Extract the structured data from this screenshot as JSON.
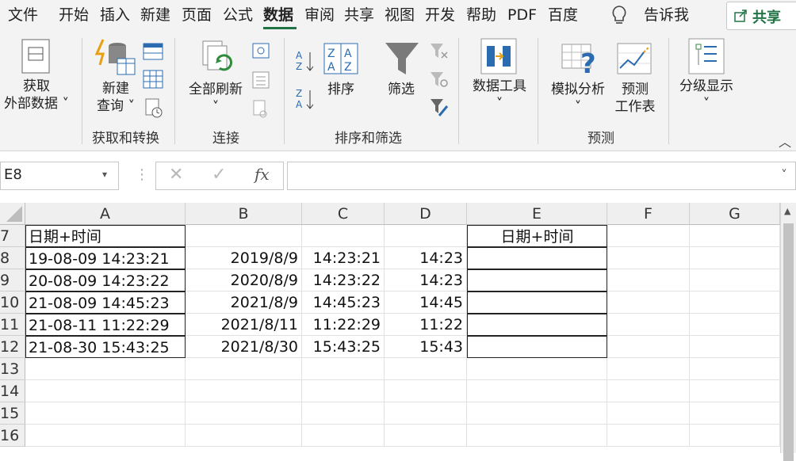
{
  "tabs": [
    "文件",
    "开始",
    "插入",
    "新建",
    "页面",
    "公式",
    "数据",
    "审阅",
    "共享",
    "视图",
    "开发",
    "帮助",
    "PDF",
    "百度"
  ],
  "active_tab": "数据",
  "tell_me": "告诉我",
  "share_label": "共享",
  "ribbon": {
    "get_external_data": [
      "获取",
      "外部数据"
    ],
    "new_query": [
      "新建",
      "查询"
    ],
    "group_get_transform": "获取和转换",
    "refresh_all": "全部刷新",
    "group_connections": "连接",
    "sort": "排序",
    "filter": "筛选",
    "group_sort_filter": "排序和筛选",
    "data_tools": "数据工具",
    "what_if": "模拟分析",
    "forecast_sheet": [
      "预测",
      "工作表"
    ],
    "group_forecast": "预测",
    "outline": "分级显示"
  },
  "formula_bar": {
    "name_box": "E8",
    "cancel": "✕",
    "enter": "✓",
    "fx": "fx",
    "formula": ""
  },
  "columns": [
    "A",
    "B",
    "C",
    "D",
    "E",
    "F",
    "G"
  ],
  "rows": [
    {
      "num": "7",
      "A": "日期+时间",
      "B": "",
      "C": "",
      "D": "",
      "E": "日期+时间"
    },
    {
      "num": "8",
      "A": "19-08-09 14:23:21",
      "B": "2019/8/9",
      "C": "14:23:21",
      "D": "14:23",
      "E": ""
    },
    {
      "num": "9",
      "A": "20-08-09 14:23:22",
      "B": "2020/8/9",
      "C": "14:23:22",
      "D": "14:23",
      "E": ""
    },
    {
      "num": "10",
      "A": "21-08-09 14:45:23",
      "B": "2021/8/9",
      "C": "14:45:23",
      "D": "14:45",
      "E": ""
    },
    {
      "num": "11",
      "A": "21-08-11 11:22:29",
      "B": "2021/8/11",
      "C": "11:22:29",
      "D": "11:22",
      "E": ""
    },
    {
      "num": "12",
      "A": "21-08-30 15:43:25",
      "B": "2021/8/30",
      "C": "15:43:25",
      "D": "15:43",
      "E": ""
    },
    {
      "num": "13",
      "A": "",
      "B": "",
      "C": "",
      "D": "",
      "E": ""
    },
    {
      "num": "14",
      "A": "",
      "B": "",
      "C": "",
      "D": "",
      "E": ""
    },
    {
      "num": "15",
      "A": "",
      "B": "",
      "C": "",
      "D": "",
      "E": ""
    },
    {
      "num": "16",
      "A": "",
      "B": "",
      "C": "",
      "D": "",
      "E": ""
    }
  ],
  "colors": {
    "accent": "#217346"
  }
}
